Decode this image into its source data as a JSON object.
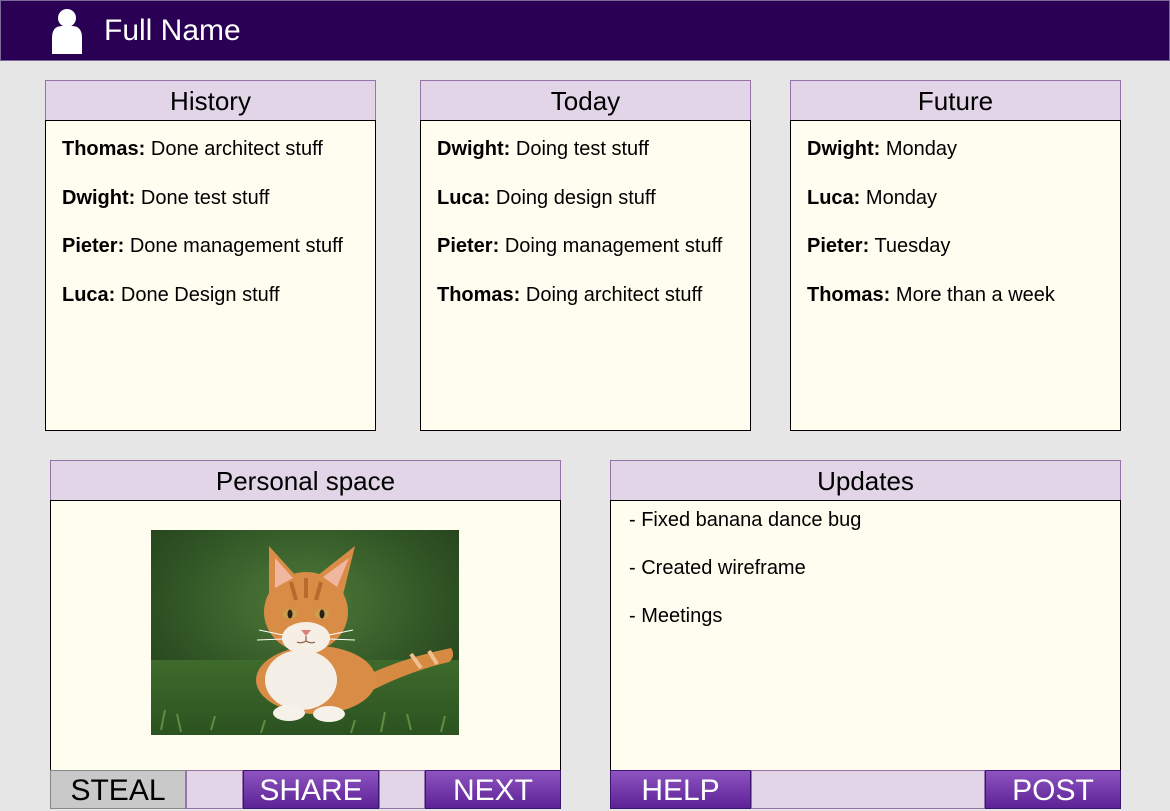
{
  "header": {
    "title": "Full Name",
    "icon": "user-icon"
  },
  "history": {
    "title": "History",
    "entries": [
      {
        "name": "Thomas:",
        "text": "Done architect stuff"
      },
      {
        "name": "Dwight:",
        "text": "Done test stuff"
      },
      {
        "name": "Pieter:",
        "text": "Done management stuff"
      },
      {
        "name": "Luca:",
        "text": "Done Design stuff"
      }
    ]
  },
  "today": {
    "title": "Today",
    "entries": [
      {
        "name": "Dwight:",
        "text": "Doing test stuff"
      },
      {
        "name": "Luca:",
        "text": "Doing design stuff"
      },
      {
        "name": "Pieter:",
        "text": "Doing management stuff"
      },
      {
        "name": "Thomas:",
        "text": "Doing architect stuff"
      }
    ]
  },
  "future": {
    "title": "Future",
    "entries": [
      {
        "name": "Dwight:",
        "text": "Monday"
      },
      {
        "name": "Luca:",
        "text": "Monday"
      },
      {
        "name": "Pieter:",
        "text": "Tuesday"
      },
      {
        "name": "Thomas:",
        "text": "More than a week"
      }
    ]
  },
  "personal": {
    "title": "Personal space",
    "buttons": {
      "steal": "STEAL",
      "share": "SHARE",
      "next": "NEXT"
    }
  },
  "updates": {
    "title": "Updates",
    "items": [
      "- Fixed banana dance bug",
      "- Created wireframe",
      "- Meetings"
    ],
    "buttons": {
      "help": "HELP",
      "post": "POST"
    }
  },
  "colors": {
    "header_bg": "#2a0054",
    "panel_title_bg": "#e1d5e7",
    "panel_body_bg": "#fffdef",
    "button_purple": "#6a2aa8",
    "button_gray": "#c9c9c9"
  }
}
